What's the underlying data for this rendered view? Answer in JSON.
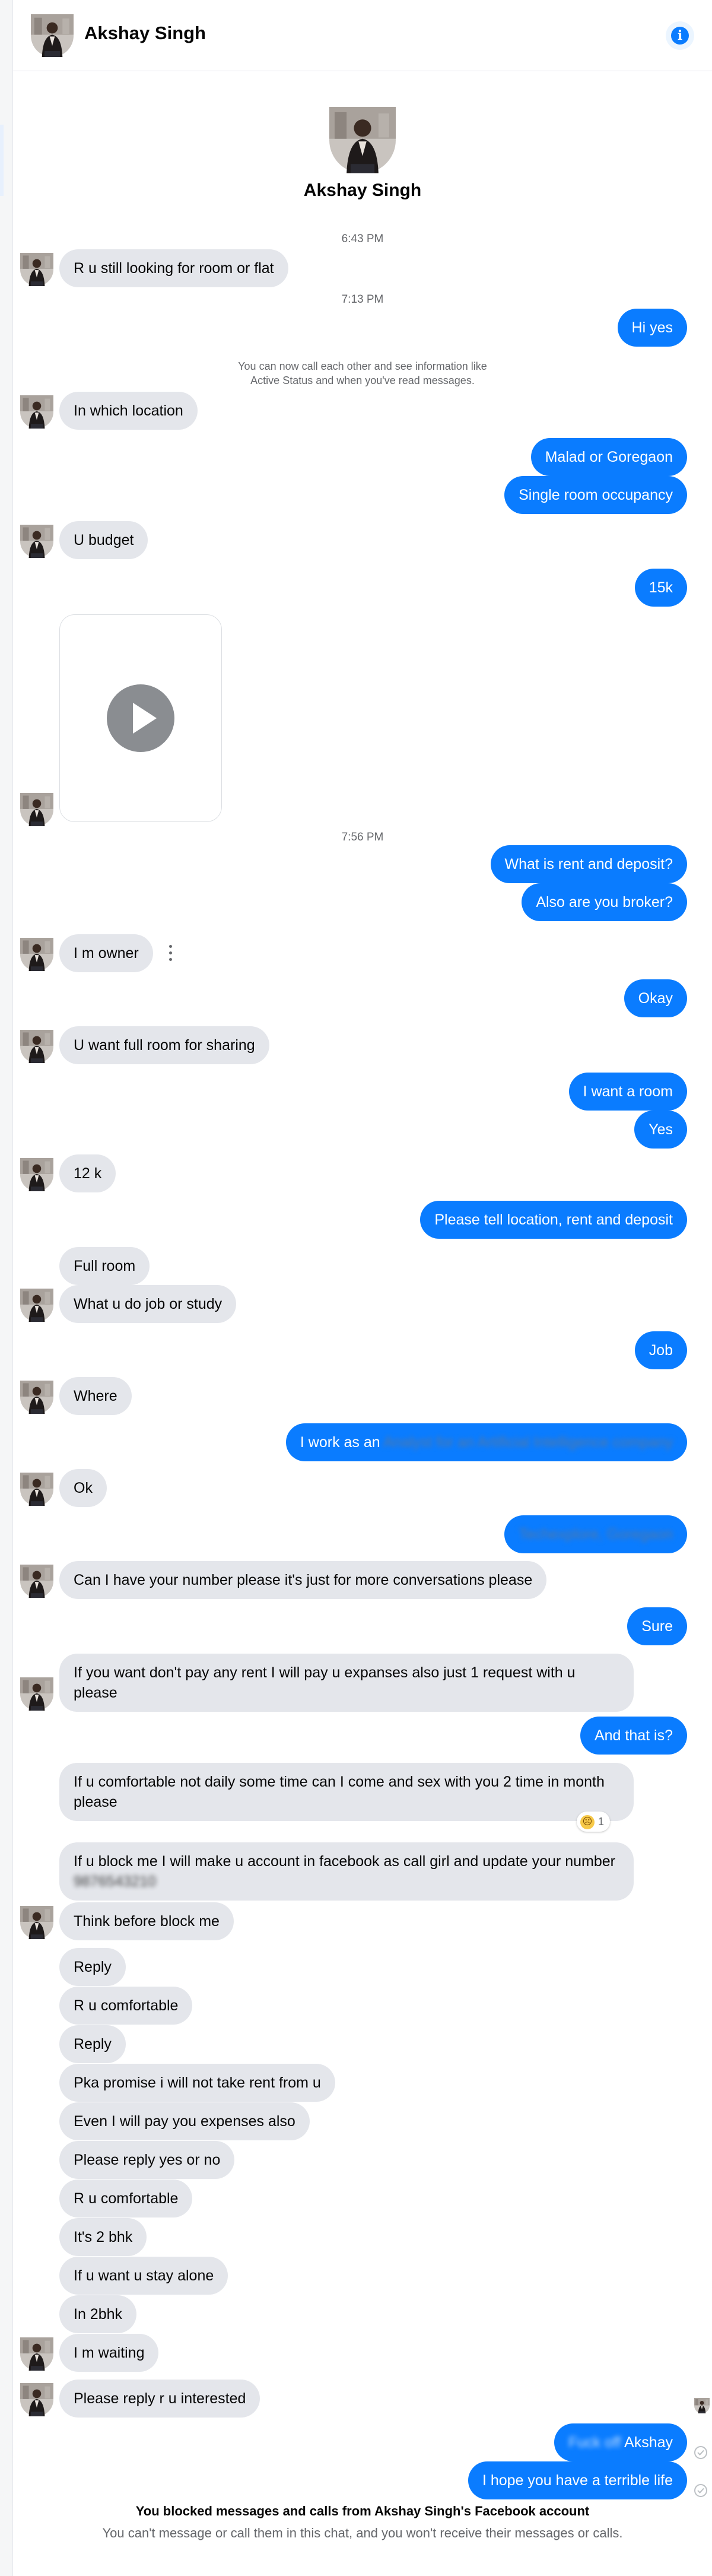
{
  "contact": {
    "name": "Akshay Singh"
  },
  "icons": {
    "info": "info-icon",
    "play": "play-icon",
    "more": "more-options-icon",
    "reaction": "angry-face-icon",
    "delivered": "check-circle-icon"
  },
  "colors": {
    "outgoing": "#0a7cff",
    "incoming": "#e4e6eb",
    "meta": "#65676b"
  },
  "header": {
    "info_symbol": "i"
  },
  "timestamps": {
    "t1": "6:43 PM",
    "t2": "7:13 PM",
    "t3": "7:56 PM"
  },
  "notice": {
    "line1": "You can now call each other and see information like",
    "line2": "Active Status and when you've read messages."
  },
  "messages": {
    "m01": "R u still looking for room or flat",
    "m02": "Hi yes",
    "m03": "In which location",
    "m04": "Malad or Goregaon",
    "m05": "Single room occupancy",
    "m06": "U budget",
    "m07": "15k",
    "m08": "What is rent and deposit?",
    "m09": "Also are you broker?",
    "m10": "I m owner",
    "m11": "Okay",
    "m12": "U want full room for sharing",
    "m13": "I want a room",
    "m14": "Yes",
    "m15": "12 k",
    "m16": "Please tell location, rent and deposit",
    "m17": "Full room",
    "m18": "What u do job or study",
    "m19": "Job",
    "m20": "Where",
    "m21_visible": "I work as an",
    "m21_hidden": "Analyst for an Artificial Intelligence company",
    "m22": "Ok",
    "m23_hidden": "Techexplore, Goregaon",
    "m24": "Can I have your number please it's just for more conversations please",
    "m25": "Sure",
    "m26": "If you want don't pay any rent I will pay u expanses also just 1 request with u please",
    "m27": "And that is?",
    "m28": "If u comfortable not daily some time can I come and sex with you 2 time in month please",
    "m28_reaction_count": "1",
    "m29": "If u block me I will make u account in facebook as call girl and update your number",
    "m29_hidden": "9876543210",
    "m30": "Think before block me",
    "m31": "Reply",
    "m32": "R u comfortable",
    "m33": "Reply",
    "m34": "Pka promise i will not take rent from u",
    "m35": "Even I will pay you expenses also",
    "m36": "Please reply yes or no",
    "m37": "R u comfortable",
    "m38": "It's 2 bhk",
    "m39": "If u want u stay alone",
    "m40": "In 2bhk",
    "m41": "I m waiting",
    "m42": "Please reply r u interested",
    "m43_hidden": "Fuck off",
    "m43_visible": "Akshay",
    "m44": "I hope you have a terrible life"
  },
  "blocked": {
    "title": "You blocked messages and calls from Akshay Singh's Facebook account",
    "subtitle": "You can't message or call them in this chat, and you won't receive their messages or calls."
  }
}
